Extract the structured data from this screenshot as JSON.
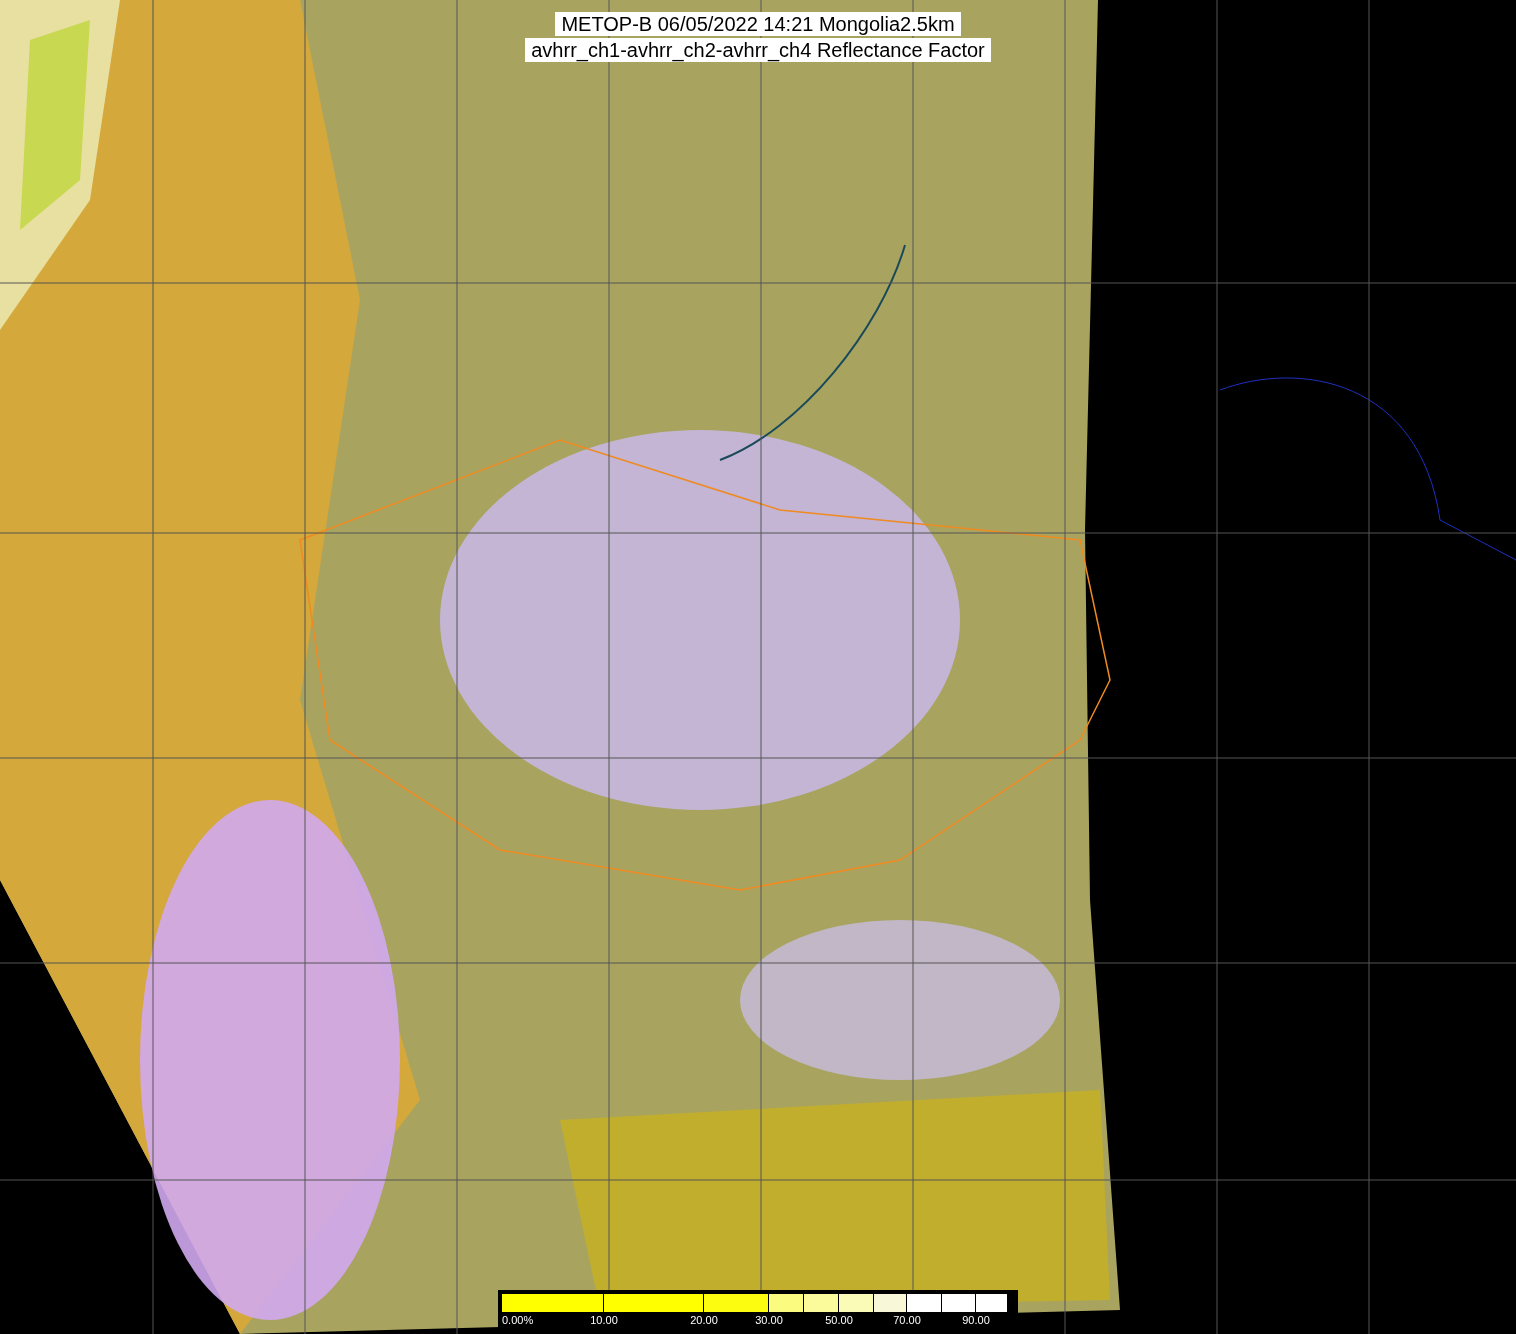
{
  "title": {
    "lines": [
      "METOP-B 06/05/2022 14:21 Mongolia2.5km",
      "avhrr_ch1-avhrr_ch2-avhrr_ch4 Reflectance Factor"
    ]
  },
  "colorbar": {
    "segments": [
      {
        "color": "#ffff00",
        "label": "0.00%"
      },
      {
        "color": "#ffff00",
        "label": "10.00"
      },
      {
        "color": "#fcfc10",
        "label": "20.00"
      },
      {
        "color": "#fbfb80",
        "label": "30.00"
      },
      {
        "color": "#fbfb9c"
      },
      {
        "color": "#fbfbb8",
        "label": "50.00"
      },
      {
        "color": "#f8f8d8"
      },
      {
        "color": "#ffffff",
        "label": "70.00"
      },
      {
        "color": "#ffffff"
      },
      {
        "color": "#ffffff",
        "label": "90.00"
      }
    ]
  }
}
